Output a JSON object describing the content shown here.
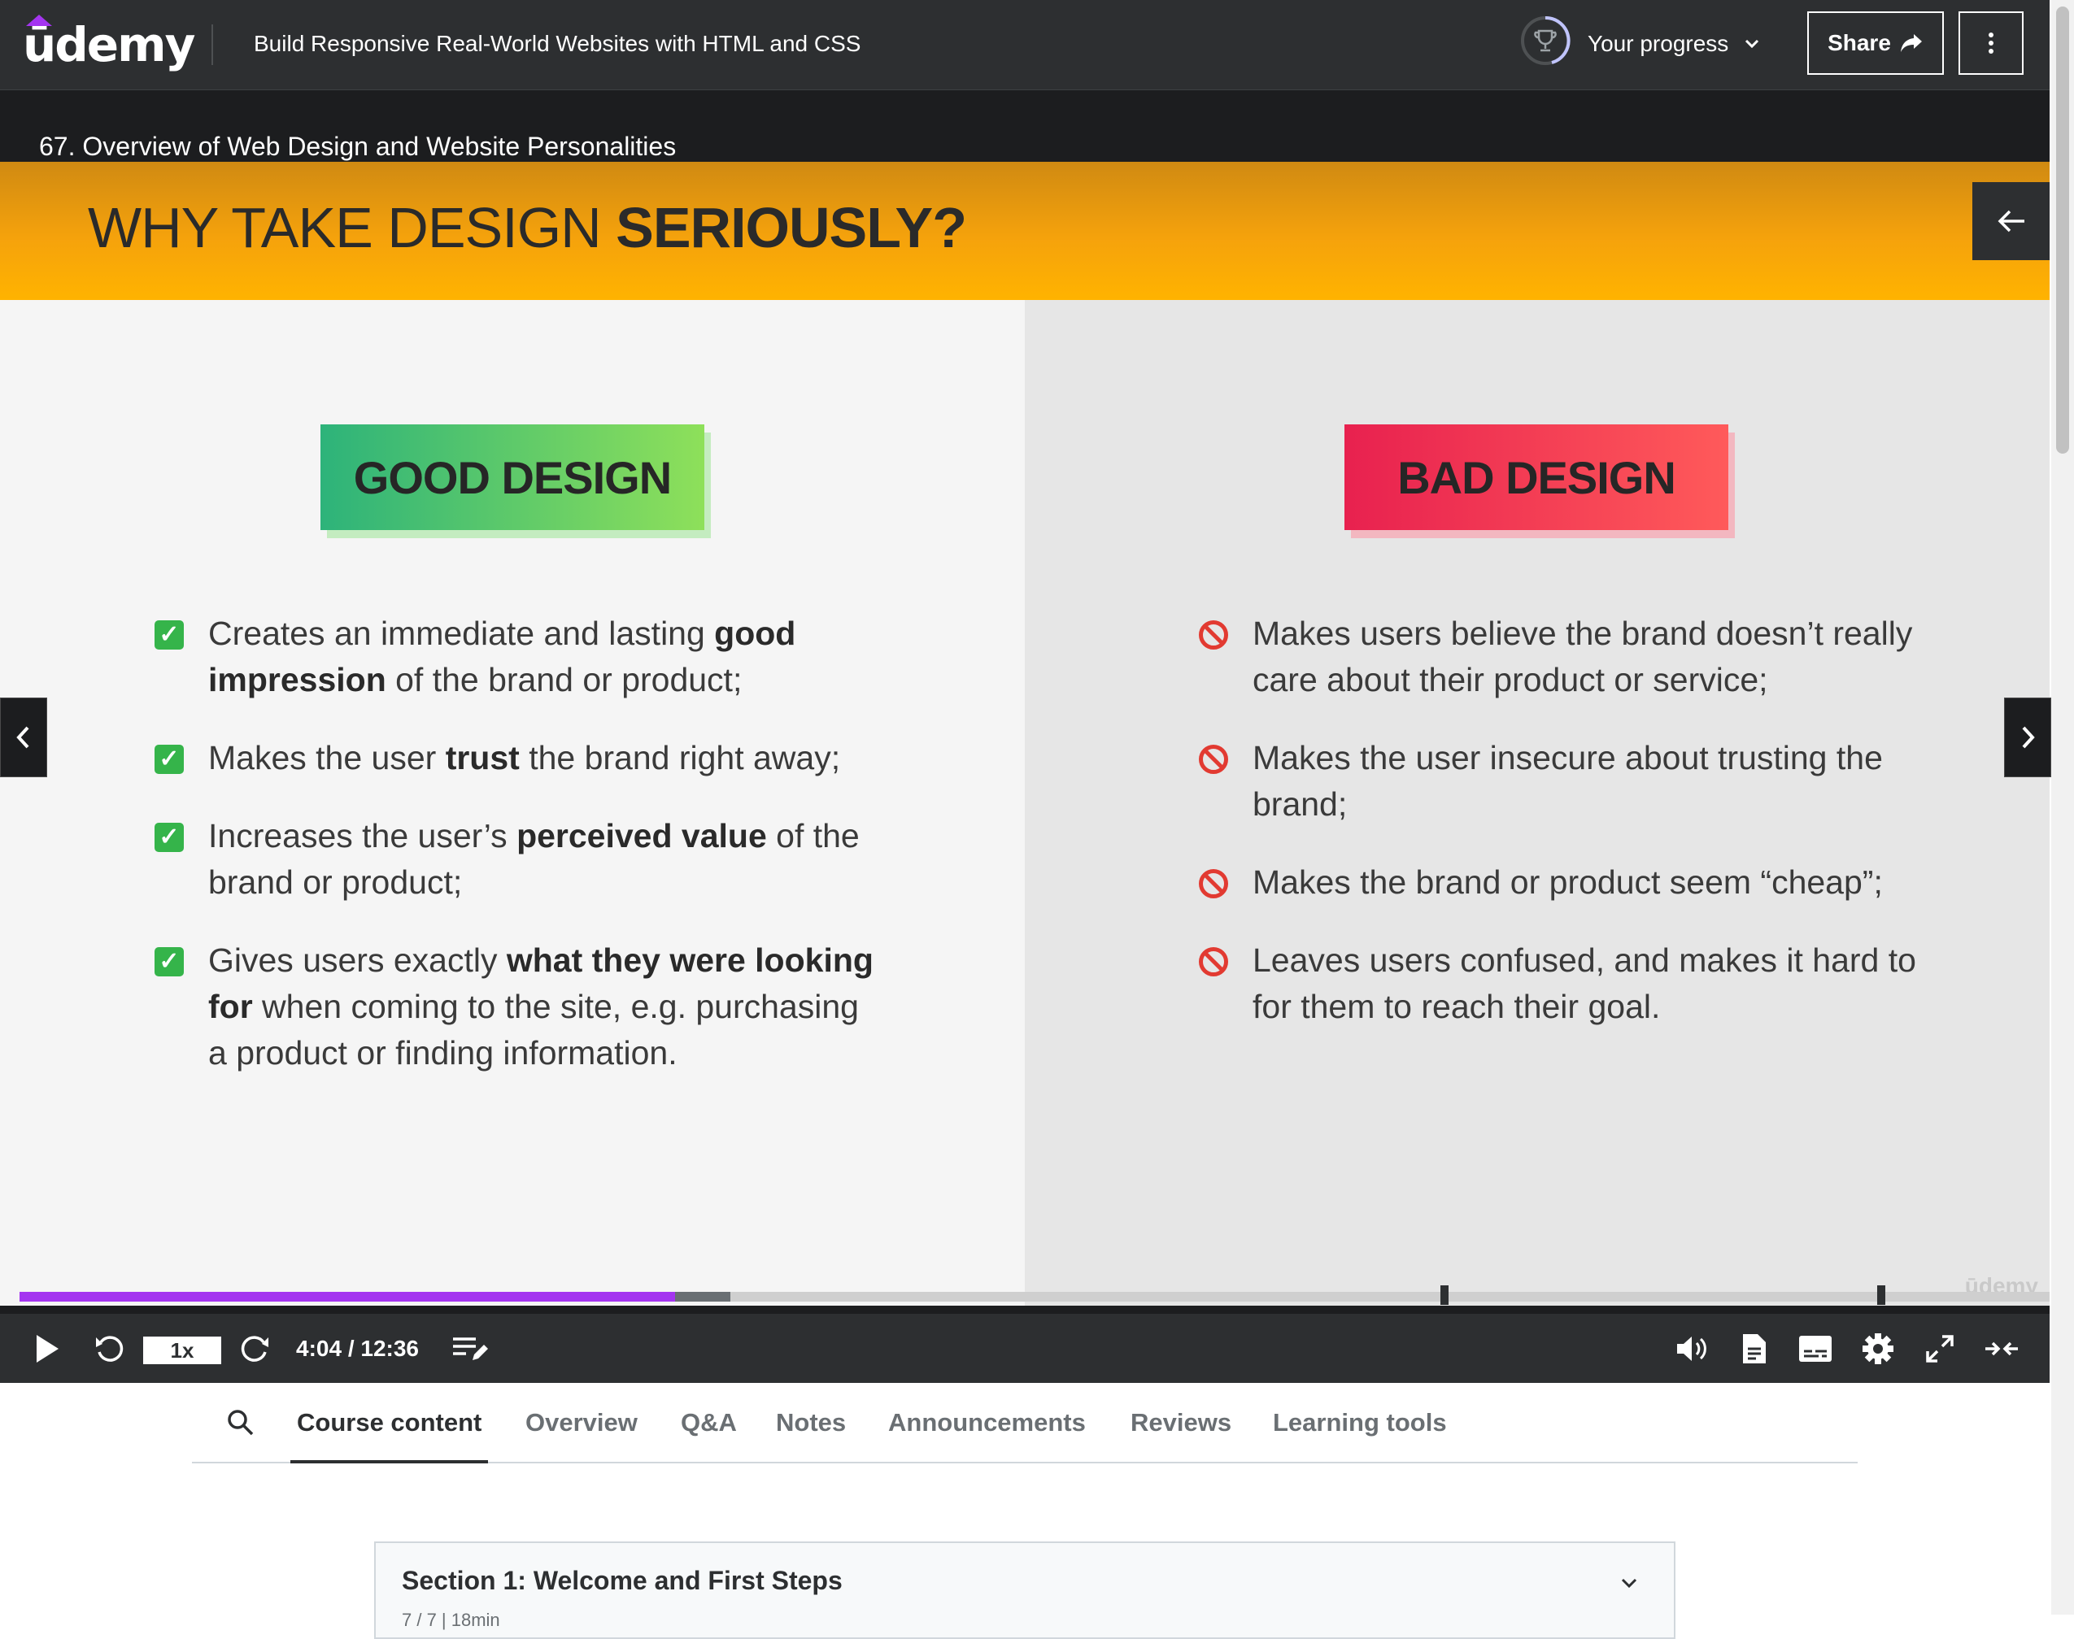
{
  "header": {
    "logo": "ūdemy",
    "course_title": "Build Responsive Real-World Websites with HTML and CSS",
    "progress_label": "Your progress",
    "share_label": "Share"
  },
  "player": {
    "lecture_title": "67. Overview of Web Design and Website Personalities",
    "speed": "1x",
    "timecode": "4:04 / 12:36",
    "progress_fraction": 0.323,
    "buffered_fraction": 0.35,
    "markers": [
      0.7,
      0.915
    ]
  },
  "slide": {
    "heading_normal": "WHY TAKE DESIGN ",
    "heading_bold": "SERIOUSLY?",
    "good_label": "GOOD DESIGN",
    "bad_label": "BAD DESIGN",
    "good_items": [
      {
        "a": "Creates an immediate and lasting ",
        "b": "good impression",
        "c": " of the brand or product;"
      },
      {
        "a": "Makes the user ",
        "b": "trust",
        "c": " the brand right away;"
      },
      {
        "a": "Increases the user’s ",
        "b": "perceived value",
        "c": " of the brand or product;"
      },
      {
        "a": "Gives users exactly ",
        "b": "what they were looking for",
        "c": " when coming to the site, e.g. purchasing a product or finding information."
      }
    ],
    "bad_items": [
      "Makes users believe the brand doesn’t really care about their product or service;",
      "Makes the user insecure about trusting the brand;",
      "Makes the brand or product seem “cheap”;",
      "Leaves users confused, and makes it hard to for them to reach their goal."
    ],
    "watermark": "ūdemy"
  },
  "tabs": [
    "Course content",
    "Overview",
    "Q&A",
    "Notes",
    "Announcements",
    "Reviews",
    "Learning tools"
  ],
  "section": {
    "title": "Section 1: Welcome and First Steps",
    "subtitle": "7 / 7 | 18min"
  },
  "colors": {
    "brand": "#a435f0",
    "dark": "#2d2f31",
    "good": "#35b44a",
    "bad": "#e23a31"
  },
  "icons": [
    "trophy-icon",
    "chevron-down-icon",
    "share-arrow-icon",
    "more-vertical-icon",
    "back-arrow-icon",
    "prev-icon",
    "next-icon",
    "play-icon",
    "rewind-icon",
    "forward-icon",
    "playlist-icon",
    "volume-icon",
    "transcript-icon",
    "captions-icon",
    "settings-icon",
    "fullscreen-icon",
    "collapse-icon",
    "search-icon"
  ]
}
